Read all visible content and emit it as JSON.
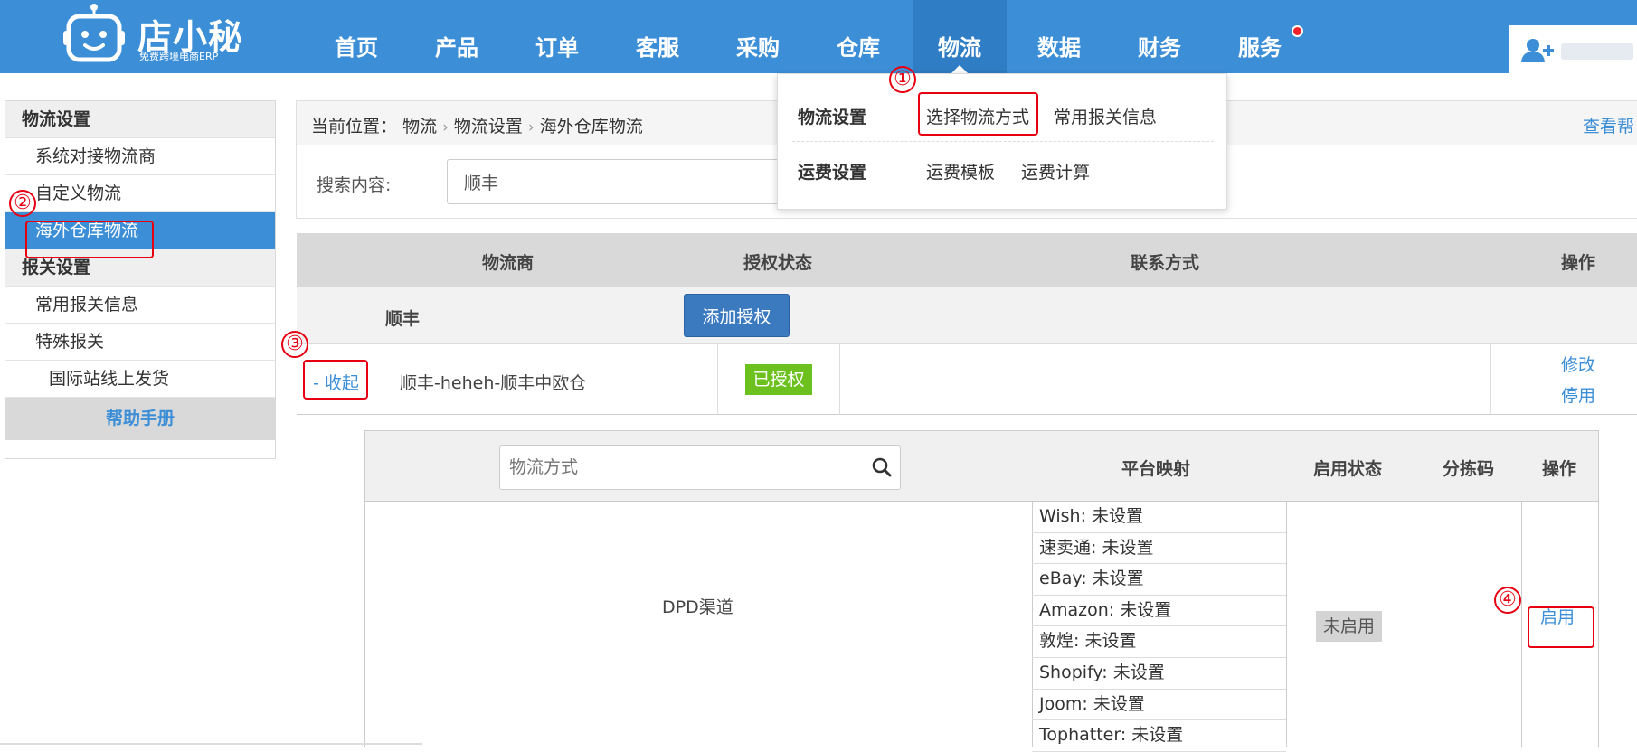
{
  "logo": {
    "title": "店小秘",
    "subtitle": "免费跨境电商ERP"
  },
  "nav": {
    "items": [
      {
        "label": "首页"
      },
      {
        "label": "产品"
      },
      {
        "label": "订单"
      },
      {
        "label": "客服"
      },
      {
        "label": "采购"
      },
      {
        "label": "仓库"
      },
      {
        "label": "物流"
      },
      {
        "label": "数据"
      },
      {
        "label": "财务"
      },
      {
        "label": "服务"
      }
    ],
    "active": "物流"
  },
  "dropdown": {
    "logistics_settings": "物流设置",
    "select_method": "选择物流方式",
    "customs_info": "常用报关信息",
    "freight_settings": "运费设置",
    "freight_template": "运费模板",
    "freight_calc": "运费计算"
  },
  "sidebar": {
    "logistics_settings": "物流设置",
    "system_carriers": "系统对接物流商",
    "custom_logistics": "自定义物流",
    "overseas_warehouse": "海外仓库物流",
    "customs_settings": "报关设置",
    "common_customs": "常用报关信息",
    "special_customs": "特殊报关",
    "intl_station": "国际站线上发货",
    "help_manual": "帮助手册"
  },
  "breadcrumb": {
    "prefix": "当前位置：",
    "level1": "物流",
    "level2": "物流设置",
    "level3": "海外仓库物流",
    "help": "查看帮"
  },
  "search": {
    "label": "搜索内容:",
    "value": "顺丰"
  },
  "carrier_table": {
    "headers": {
      "carrier": "物流商",
      "auth_status": "授权状态",
      "contact": "联系方式",
      "ops": "操作"
    },
    "group": {
      "name": "顺丰",
      "add_auth": "添加授权"
    },
    "row": {
      "collapse": "- 收起",
      "name": "顺丰-heheh-顺丰中欧仓",
      "status": "已授权",
      "edit": "修改",
      "disable": "停用"
    }
  },
  "method_table": {
    "search_placeholder": "物流方式",
    "headers": {
      "platform_mapping": "平台映射",
      "enable_status": "启用状态",
      "sort_code": "分拣码",
      "ops": "操作"
    },
    "method_name": "DPD渠道",
    "mappings": [
      "Wish:  未设置",
      "速卖通:  未设置",
      "eBay:  未设置",
      "Amazon:  未设置",
      "敦煌:  未设置",
      "Shopify:  未设置",
      "Joom:  未设置",
      "Tophatter:  未设置"
    ],
    "status": "未启用",
    "enable": "启用"
  },
  "annotations": [
    "①",
    "②",
    "③",
    "④"
  ],
  "colors": {
    "brand": "#3c8fd7",
    "annotation": "#e60012",
    "authorized": "#6cc11f"
  }
}
